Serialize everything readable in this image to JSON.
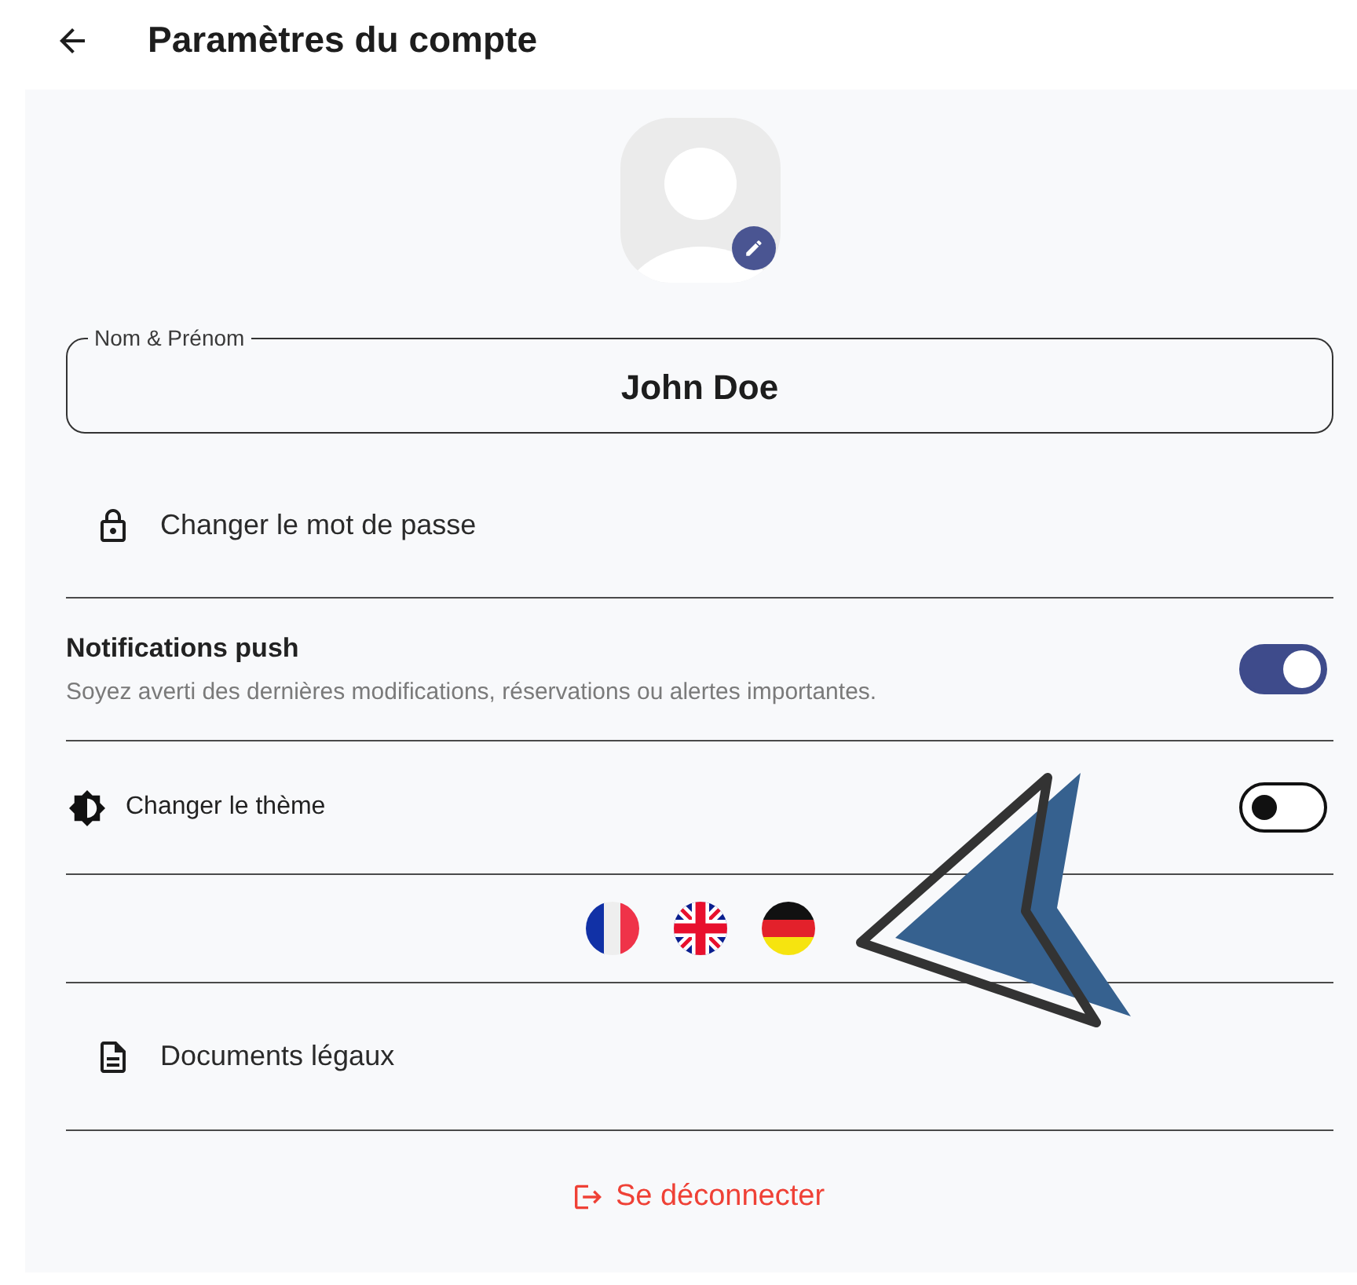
{
  "header": {
    "title": "Paramètres du compte"
  },
  "name_field": {
    "label": "Nom & Prénom",
    "value": "John Doe"
  },
  "password_link": {
    "label": "Changer le mot de passe"
  },
  "notifications": {
    "title": "Notifications push",
    "subtitle": "Soyez averti des dernières modifications, réservations ou alertes importantes.",
    "on": true
  },
  "theme": {
    "label": "Changer le thème",
    "on": false
  },
  "legal_link": {
    "label": "Documents légaux"
  },
  "logout": {
    "label": "Se déconnecter"
  }
}
